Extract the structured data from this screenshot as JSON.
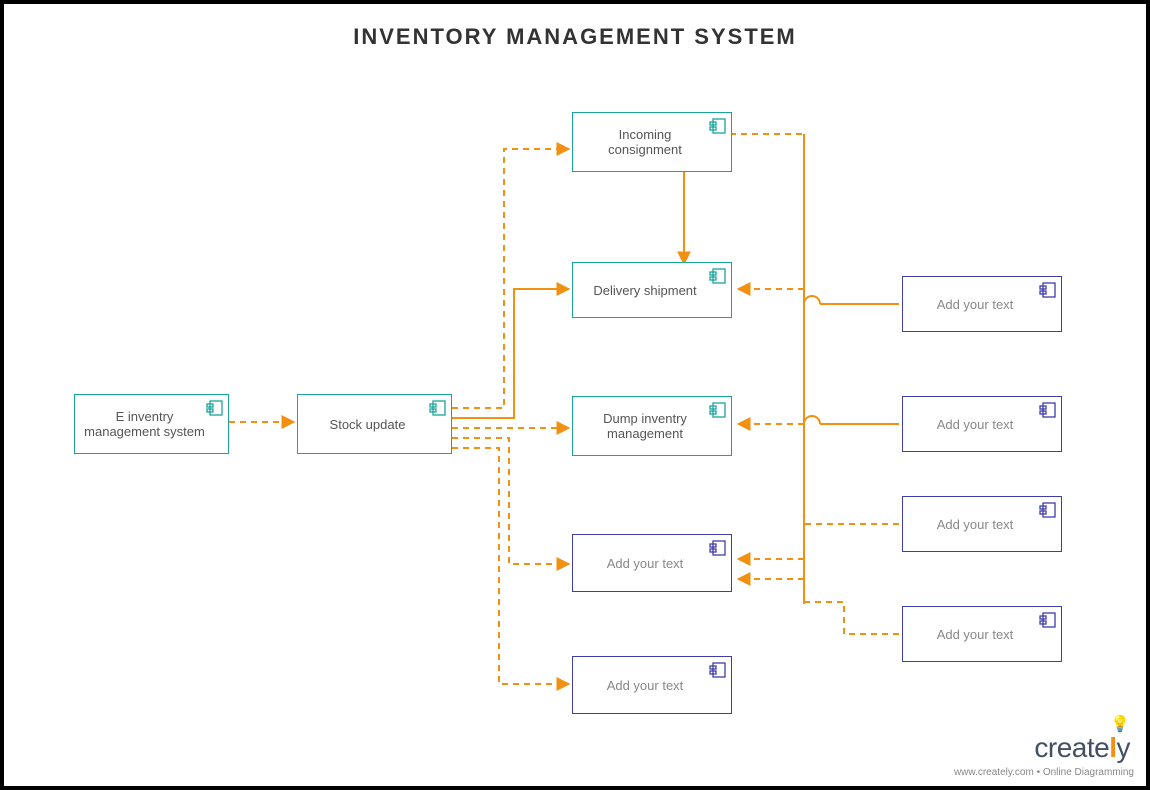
{
  "title": "INVENTORY MANAGEMENT SYSTEM",
  "nodes": {
    "n1": "E inventry management system",
    "n2": "Stock update",
    "n3": "Incoming consignment",
    "n4": "Delivery shipment",
    "n5": "Dump inventry management",
    "n6": "Add your text",
    "n7": "Add your text",
    "r1": "Add your text",
    "r2": "Add your text",
    "r3": "Add your text",
    "r4": "Add your text"
  },
  "colors": {
    "teal": "#1aa59a",
    "purple": "#3f3da8",
    "connector": "#f29111"
  },
  "footer": {
    "brand_prefix": "create",
    "brand_accent": "l",
    "brand_suffix": "y",
    "subline": "www.creately.com • Online Diagramming"
  }
}
